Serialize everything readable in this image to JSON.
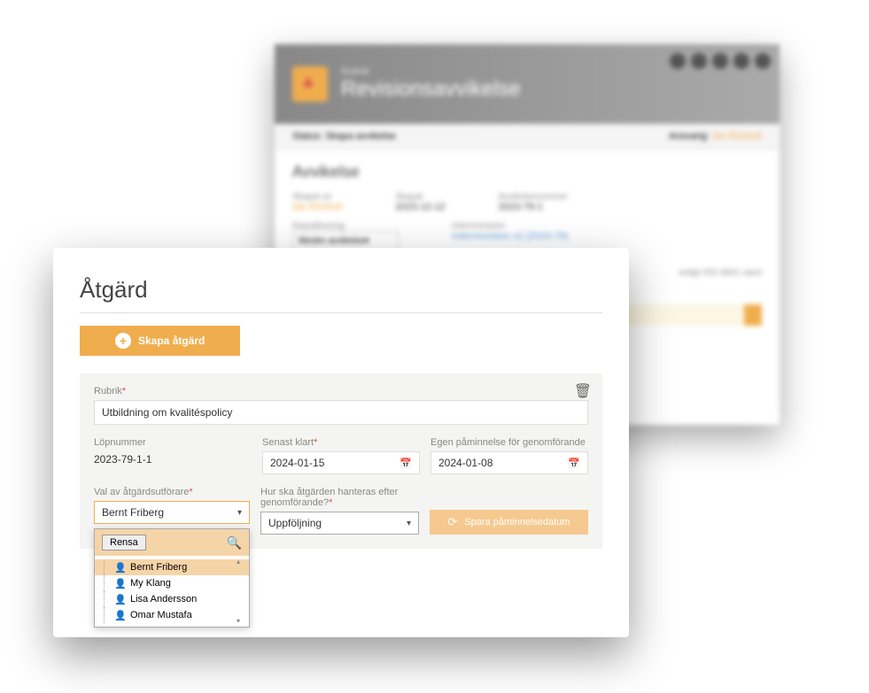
{
  "background": {
    "header_small": "Rubrik",
    "header_title": "Revisionsavvikelse",
    "status_label": "Status:",
    "status_value": "Skapa avvikelse",
    "responsible_label": "Ansvarig:",
    "responsible_value": "Ida Rönholt",
    "section_title": "Avvikelse",
    "fields": {
      "created_by_label": "Skapat av",
      "created_by_value": "Ida Rönholt",
      "created_label": "Skapat",
      "created_value": "2023-12-12",
      "deviation_number_label": "Avvikelsenummer",
      "deviation_number_value": "2023-79-1",
      "classification_label": "Klassificering",
      "classification_value": "Mindre avvikelse",
      "internal_revision_label": "Internrevision",
      "internal_revision_value": "Internrevision v2 (2023-79)"
    },
    "note_text": "enligt ISO 9001 samt"
  },
  "foreground": {
    "title": "Åtgärd",
    "create_button": "Skapa åtgärd",
    "panel": {
      "rubrik_label": "Rubrik",
      "rubrik_value": "Utbildning om kvalitéspolicy",
      "lopnummer_label": "Löpnummer",
      "lopnummer_value": "2023-79-1-1",
      "senast_klart_label": "Senast klart",
      "senast_klart_value": "2024-01-15",
      "paminnelse_label": "Egen påminnelse för genomförande",
      "paminnelse_value": "2024-01-08",
      "utforare_label": "Val av åtgärdsutförare",
      "utforare_value": "Bernt Friberg",
      "hantera_label": "Hur ska åtgärden hanteras efter genomförande?",
      "hantera_value": "Uppföljning",
      "save_reminder": "Spara påminnelsedatum"
    },
    "dropdown": {
      "clear": "Rensa",
      "options": [
        "Bernt Friberg",
        "My Klang",
        "Lisa Andersson",
        "Omar Mustafa"
      ]
    }
  }
}
